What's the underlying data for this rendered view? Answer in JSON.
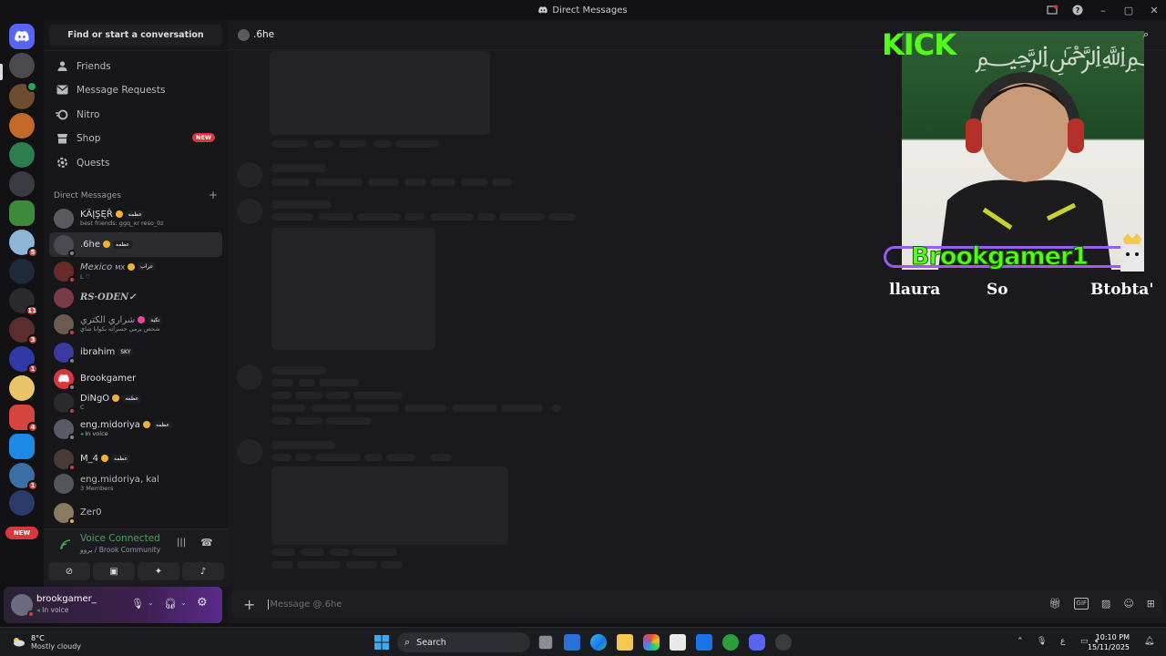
{
  "window": {
    "title": "Direct Messages"
  },
  "sidebar": {
    "find_label": "Find or start a conversation",
    "nav": [
      {
        "label": "Friends",
        "icon": "friends-icon"
      },
      {
        "label": "Message Requests",
        "icon": "mail-icon"
      },
      {
        "label": "Nitro",
        "icon": "nitro-icon"
      },
      {
        "label": "Shop",
        "icon": "shop-icon",
        "badge": "NEW"
      },
      {
        "label": "Quests",
        "icon": "quests-icon"
      }
    ],
    "dm_header": "Direct Messages",
    "dm_add": "+",
    "dms": [
      {
        "name": "KÄĮŞĘŘ",
        "tag": "عظمه",
        "sub": "best friends: ggq_xr reso_0z"
      },
      {
        "name": ".6he",
        "tag": "عظمه",
        "sub": ""
      },
      {
        "name": "Mexico",
        "extra": "MX",
        "tag": "عراب",
        "sub": "L ♡"
      },
      {
        "name": "RS·ODEN✓",
        "tag": "",
        "sub": ""
      },
      {
        "name": "شراري الكتري",
        "tag": "تكية",
        "sub": "شخص يرمي حسراته بكوابا شاي"
      },
      {
        "name": "ibrahim",
        "tag": "SKY",
        "sub": ""
      },
      {
        "name": "Brookgamer",
        "tag": "",
        "sub": ""
      },
      {
        "name": "DiNgO",
        "tag": "عظمه",
        "sub": "C"
      },
      {
        "name": "eng.midoriya",
        "tag": "عظمه",
        "sub": "In voice"
      },
      {
        "name": "M_4",
        "tag": "عظمه",
        "sub": ""
      },
      {
        "name": "eng.midoriya, kal",
        "tag": "",
        "sub": "3 Members"
      },
      {
        "name": "Zer0",
        "tag": "",
        "sub": ""
      }
    ],
    "rail_new": "NEW",
    "rail_badges": [
      "5",
      "11",
      "3",
      "1",
      "4",
      "1"
    ]
  },
  "voice": {
    "status": "Voice Connected",
    "server": "بروو / Brook Community"
  },
  "user": {
    "name": "brookgamer_",
    "status": "In voice"
  },
  "main": {
    "channel_name": ".6he",
    "composer_placeholder": "Message @.6he"
  },
  "overlay": {
    "kick_logo": "KICK",
    "streamer": "Brookgamer1",
    "sublabels": [
      "llaura",
      "So",
      "Btobta'"
    ]
  },
  "taskbar": {
    "temp": "8°C",
    "weather": "Mostly cloudy",
    "search": "Search",
    "time": "10:10 PM",
    "date": "15/11/2025",
    "lang": "ع"
  },
  "colors": {
    "accent": "#5865f2",
    "online": "#23a55a",
    "badge": "#da373c",
    "kick_green": "#53fc18",
    "overlay_purple": "#9b5cf0"
  }
}
